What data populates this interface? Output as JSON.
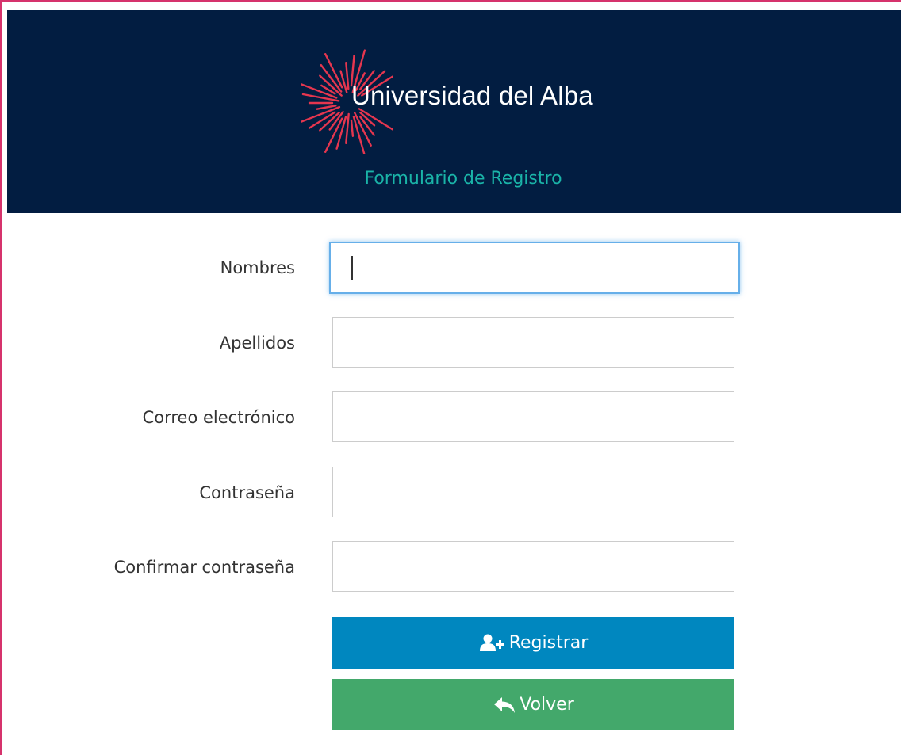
{
  "header": {
    "brand": "Universidad del Alba",
    "form_title": "Formulario de Registro",
    "colors": {
      "background": "#021d41",
      "accent": "#e5364f",
      "title": "#1ab4a8"
    }
  },
  "form": {
    "fields": [
      {
        "label": "Nombres",
        "value": "",
        "focused": true
      },
      {
        "label": "Apellidos",
        "value": ""
      },
      {
        "label": "Correo electrónico",
        "value": ""
      },
      {
        "label": "Contraseña",
        "value": ""
      },
      {
        "label": "Confirmar contraseña",
        "value": ""
      }
    ],
    "register_label": "Registrar",
    "register_icon": "user-add-icon",
    "back_label": "Volver",
    "back_icon": "reply-arrow-icon",
    "colors": {
      "register": "#0087bf",
      "back": "#43a86b"
    }
  }
}
